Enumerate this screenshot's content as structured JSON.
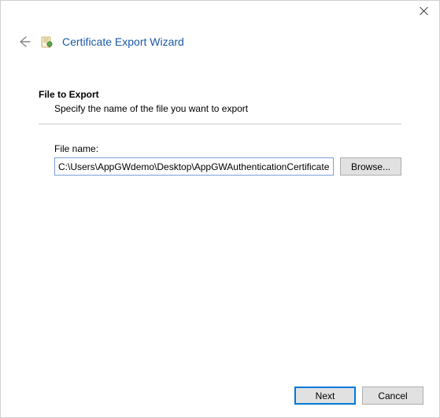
{
  "window": {
    "title": "Certificate Export Wizard"
  },
  "page": {
    "heading": "File to Export",
    "subheading": "Specify the name of the file you want to export"
  },
  "form": {
    "filename_label": "File name:",
    "filename_value": "C:\\Users\\AppGWdemo\\Desktop\\AppGWAuthenticationCertificate.cer",
    "browse_label": "Browse..."
  },
  "footer": {
    "next_label": "Next",
    "cancel_label": "Cancel"
  }
}
